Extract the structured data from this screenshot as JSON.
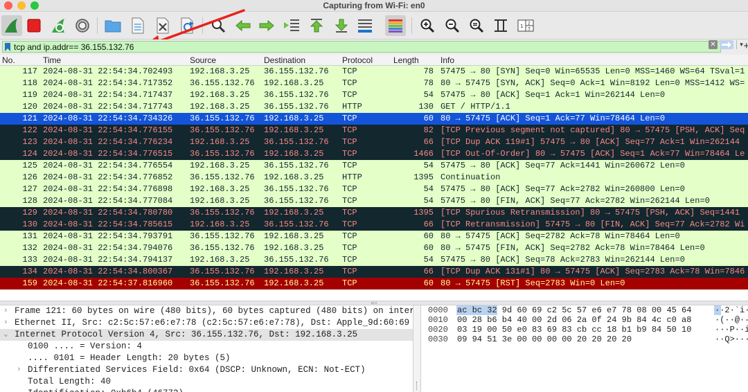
{
  "window": {
    "title": "Capturing from Wi-Fi: en0",
    "traffic_light_colors": [
      "#fe5f57",
      "#febc2e",
      "#28c840"
    ]
  },
  "toolbar": {
    "buttons": [
      {
        "name": "start-capture",
        "icon": "shark-fin-icon"
      },
      {
        "name": "stop-capture",
        "icon": "stop-square-icon"
      },
      {
        "name": "restart-capture",
        "icon": "restart-icon"
      },
      {
        "name": "capture-options",
        "icon": "gear-icon"
      },
      {
        "name": "open-file",
        "icon": "folder-icon"
      },
      {
        "name": "save-file",
        "icon": "file-icon"
      },
      {
        "name": "close-file",
        "icon": "close-file-icon"
      },
      {
        "name": "reload-file",
        "icon": "reload-icon"
      },
      {
        "name": "find-packet",
        "icon": "magnifier-icon"
      },
      {
        "name": "go-back",
        "icon": "arrow-left-icon"
      },
      {
        "name": "go-forward",
        "icon": "arrow-right-icon"
      },
      {
        "name": "go-to-packet",
        "icon": "goto-packet-icon"
      },
      {
        "name": "go-first",
        "icon": "arrow-up-icon"
      },
      {
        "name": "go-last",
        "icon": "arrow-down-icon"
      },
      {
        "name": "auto-scroll",
        "icon": "auto-scroll-icon"
      },
      {
        "name": "colorize",
        "icon": "colorize-icon"
      },
      {
        "name": "zoom-in",
        "icon": "zoom-in-icon"
      },
      {
        "name": "zoom-out",
        "icon": "zoom-out-icon"
      },
      {
        "name": "zoom-reset",
        "icon": "zoom-normal-icon"
      },
      {
        "name": "resize-columns",
        "icon": "resize-columns-icon"
      },
      {
        "name": "layout",
        "icon": "layout-icon"
      }
    ]
  },
  "filter": {
    "value": "tcp and ip.addr== 36.155.132.76",
    "bg_color": "#c8f5c0"
  },
  "columns": {
    "no": "No.",
    "time": "Time",
    "source": "Source",
    "destination": "Destination",
    "protocol": "Protocol",
    "length": "Length",
    "info": "Info"
  },
  "packets": [
    {
      "no": "117",
      "time": "2024-08-31 22:54:34.702493",
      "src": "192.168.3.25",
      "dst": "36.155.132.76",
      "proto": "TCP",
      "len": "78",
      "info": "57475 → 80 [SYN] Seq=0 Win=65535 Len=0 MSS=1460 WS=64 TSval=1",
      "bg": "#e4ffc7",
      "fg": "#12272e"
    },
    {
      "no": "118",
      "time": "2024-08-31 22:54:34.717352",
      "src": "36.155.132.76",
      "dst": "192.168.3.25",
      "proto": "TCP",
      "len": "78",
      "info": "80 → 57475 [SYN, ACK] Seq=0 Ack=1 Win=8192 Len=0 MSS=1412 WS=",
      "bg": "#e4ffc7",
      "fg": "#12272e"
    },
    {
      "no": "119",
      "time": "2024-08-31 22:54:34.717437",
      "src": "192.168.3.25",
      "dst": "36.155.132.76",
      "proto": "TCP",
      "len": "54",
      "info": "57475 → 80 [ACK] Seq=1 Ack=1 Win=262144 Len=0",
      "bg": "#e4ffc7",
      "fg": "#12272e"
    },
    {
      "no": "120",
      "time": "2024-08-31 22:54:34.717743",
      "src": "192.168.3.25",
      "dst": "36.155.132.76",
      "proto": "HTTP",
      "len": "130",
      "info": "GET / HTTP/1.1",
      "bg": "#e4ffc7",
      "fg": "#12272e"
    },
    {
      "no": "121",
      "time": "2024-08-31 22:54:34.734326",
      "src": "36.155.132.76",
      "dst": "192.168.3.25",
      "proto": "TCP",
      "len": "60",
      "info": "80 → 57475 [ACK] Seq=1 Ack=77 Win=78464 Len=0",
      "bg": "#1454d9",
      "fg": "#ffffff"
    },
    {
      "no": "122",
      "time": "2024-08-31 22:54:34.776155",
      "src": "36.155.132.76",
      "dst": "192.168.3.25",
      "proto": "TCP",
      "len": "82",
      "info": "[TCP Previous segment not captured] 80 → 57475 [PSH, ACK] Seq",
      "bg": "#12272e",
      "fg": "#f78787"
    },
    {
      "no": "123",
      "time": "2024-08-31 22:54:34.776234",
      "src": "192.168.3.25",
      "dst": "36.155.132.76",
      "proto": "TCP",
      "len": "66",
      "info": "[TCP Dup ACK 119#1] 57475 → 80 [ACK] Seq=77 Ack=1 Win=262144",
      "bg": "#12272e",
      "fg": "#f78787"
    },
    {
      "no": "124",
      "time": "2024-08-31 22:54:34.776515",
      "src": "36.155.132.76",
      "dst": "192.168.3.25",
      "proto": "TCP",
      "len": "1466",
      "info": "[TCP Out-Of-Order] 80 → 57475 [ACK] Seq=1 Ack=77 Win=78464 Le",
      "bg": "#12272e",
      "fg": "#f78787"
    },
    {
      "no": "125",
      "time": "2024-08-31 22:54:34.776554",
      "src": "192.168.3.25",
      "dst": "36.155.132.76",
      "proto": "TCP",
      "len": "54",
      "info": "57475 → 80 [ACK] Seq=77 Ack=1441 Win=260672 Len=0",
      "bg": "#e4ffc7",
      "fg": "#12272e"
    },
    {
      "no": "126",
      "time": "2024-08-31 22:54:34.776852",
      "src": "36.155.132.76",
      "dst": "192.168.3.25",
      "proto": "HTTP",
      "len": "1395",
      "info": "Continuation",
      "bg": "#e4ffc7",
      "fg": "#12272e"
    },
    {
      "no": "127",
      "time": "2024-08-31 22:54:34.776898",
      "src": "192.168.3.25",
      "dst": "36.155.132.76",
      "proto": "TCP",
      "len": "54",
      "info": "57475 → 80 [ACK] Seq=77 Ack=2782 Win=260800 Len=0",
      "bg": "#e4ffc7",
      "fg": "#12272e"
    },
    {
      "no": "128",
      "time": "2024-08-31 22:54:34.777084",
      "src": "192.168.3.25",
      "dst": "36.155.132.76",
      "proto": "TCP",
      "len": "54",
      "info": "57475 → 80 [FIN, ACK] Seq=77 Ack=2782 Win=262144 Len=0",
      "bg": "#e4ffc7",
      "fg": "#12272e"
    },
    {
      "no": "129",
      "time": "2024-08-31 22:54:34.780780",
      "src": "36.155.132.76",
      "dst": "192.168.3.25",
      "proto": "TCP",
      "len": "1395",
      "info": "[TCP Spurious Retransmission] 80 → 57475 [PSH, ACK] Seq=1441",
      "bg": "#12272e",
      "fg": "#f78787"
    },
    {
      "no": "130",
      "time": "2024-08-31 22:54:34.785615",
      "src": "192.168.3.25",
      "dst": "36.155.132.76",
      "proto": "TCP",
      "len": "66",
      "info": "[TCP Retransmission] 57475 → 80 [FIN, ACK] Seq=77 Ack=2782 Wi",
      "bg": "#12272e",
      "fg": "#f78787"
    },
    {
      "no": "131",
      "time": "2024-08-31 22:54:34.793791",
      "src": "36.155.132.76",
      "dst": "192.168.3.25",
      "proto": "TCP",
      "len": "60",
      "info": "80 → 57475 [ACK] Seq=2782 Ack=78 Win=78464 Len=0",
      "bg": "#e4ffc7",
      "fg": "#12272e"
    },
    {
      "no": "132",
      "time": "2024-08-31 22:54:34.794076",
      "src": "36.155.132.76",
      "dst": "192.168.3.25",
      "proto": "TCP",
      "len": "60",
      "info": "80 → 57475 [FIN, ACK] Seq=2782 Ack=78 Win=78464 Len=0",
      "bg": "#e4ffc7",
      "fg": "#12272e"
    },
    {
      "no": "133",
      "time": "2024-08-31 22:54:34.794137",
      "src": "192.168.3.25",
      "dst": "36.155.132.76",
      "proto": "TCP",
      "len": "54",
      "info": "57475 → 80 [ACK] Seq=78 Ack=2783 Win=262144 Len=0",
      "bg": "#e4ffc7",
      "fg": "#12272e"
    },
    {
      "no": "134",
      "time": "2024-08-31 22:54:34.800367",
      "src": "36.155.132.76",
      "dst": "192.168.3.25",
      "proto": "TCP",
      "len": "66",
      "info": "[TCP Dup ACK 131#1] 80 → 57475 [ACK] Seq=2783 Ack=78 Win=7846",
      "bg": "#12272e",
      "fg": "#f78787"
    },
    {
      "no": "159",
      "time": "2024-08-31 22:54:37.816960",
      "src": "36.155.132.76",
      "dst": "192.168.3.25",
      "proto": "TCP",
      "len": "60",
      "info": "80 → 57475 [RST] Seq=2783 Win=0 Len=0",
      "bg": "#a40000",
      "fg": "#fffc9c"
    }
  ],
  "details": [
    {
      "toggle": "›",
      "text": "Frame 121: 60 bytes on wire (480 bits), 60 bytes captured (480 bits) on interf",
      "child": false,
      "hl": false
    },
    {
      "toggle": "›",
      "text": "Ethernet II, Src: c2:5c:57:e6:e7:78 (c2:5c:57:e6:e7:78), Dst: Apple_9d:60:69 (",
      "child": false,
      "hl": false
    },
    {
      "toggle": "⌄",
      "text": "Internet Protocol Version 4, Src: 36.155.132.76, Dst: 192.168.3.25",
      "child": false,
      "hl": true
    },
    {
      "toggle": "",
      "text": "0100 .... = Version: 4",
      "child": true,
      "hl": false
    },
    {
      "toggle": "",
      "text": ".... 0101 = Header Length: 20 bytes (5)",
      "child": true,
      "hl": false
    },
    {
      "toggle": "›",
      "text": "Differentiated Services Field: 0x64 (DSCP: Unknown, ECN: Not-ECT)",
      "child": true,
      "hl": false
    },
    {
      "toggle": "",
      "text": "Total Length: 40",
      "child": true,
      "hl": false
    },
    {
      "toggle": "",
      "text": "Identification: 0xb6b4 (46772)",
      "child": true,
      "hl": false
    }
  ],
  "hex": [
    {
      "offset": "0000",
      "bytes": "ac bc 32 9d 60 69 c2 5c  57 e6 e7 78 08 00 45 64",
      "ascii": "··2·`i·\\"
    },
    {
      "offset": "0010",
      "bytes": "00 28 b6 b4 40 00 2d 06  2a 0f 24 9b 84 4c c0 a8",
      "ascii": "·(··@·-·"
    },
    {
      "offset": "0020",
      "bytes": "03 19 00 50 e0 83 69 83  cb cc 18 b1 b9 84 50 10",
      "ascii": "···P··i·"
    },
    {
      "offset": "0030",
      "bytes": "09 94 51 3e 00 00 00 00  20 20 20 20",
      "ascii": "··Q>····"
    }
  ]
}
